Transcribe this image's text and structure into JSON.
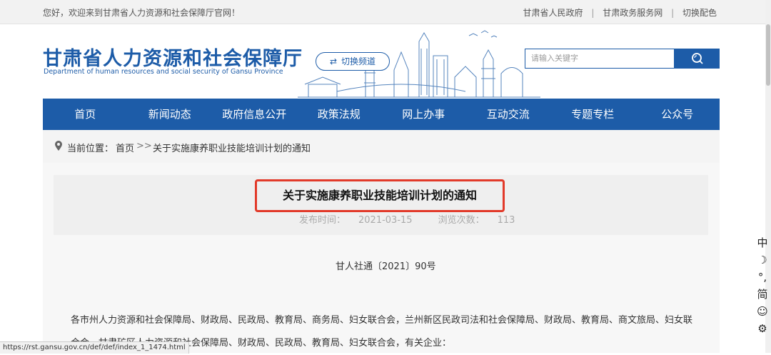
{
  "topbar": {
    "welcome": "您好，欢迎来到甘肃省人力资源和社会保障厅官网！",
    "links": [
      "甘肃省人民政府",
      "甘肃政务服务网",
      "切换配色"
    ],
    "separator": "|"
  },
  "header": {
    "title_cn": "甘肃省人力资源和社会保障厅",
    "title_en": "Department of human resources and social security of Gansu Province",
    "switch_label": "切换频道",
    "search_placeholder": "请输入关键字"
  },
  "nav": {
    "items": [
      "首页",
      "新闻动态",
      "政府信息公开",
      "政策法规",
      "网上办事",
      "互动交流",
      "专题专栏",
      "公众号"
    ]
  },
  "breadcrumb": {
    "label": "当前位置：",
    "home": "首页",
    "arrows": ">>",
    "current": "关于实施康养职业技能培训计划的通知"
  },
  "article": {
    "title": "关于实施康养职业技能培训计划的通知",
    "publish_label": "发布时间：",
    "publish_date": "2021-03-15",
    "views_label": "浏览次数：",
    "views": "113",
    "doc_number": "甘人社通〔2021〕90号",
    "paragraph": "各市州人力资源和社会保障局、财政局、民政局、教育局、商务局、妇女联合会，兰州新区民政司法和社会保障局、财政局、教育局、商文旅局、妇女联合会，甘肃矿区人力资源和社会保障局、财政局、民政局、教育局、妇女联合会，有关企业："
  },
  "status_url": "https://rst.gansu.gov.cn/def/def/index_1_1474.html",
  "tools": [
    "中",
    "☽",
    "°,",
    "简",
    "☺",
    "⚙"
  ],
  "icons": {
    "location": "location-pin-icon",
    "search": "search-icon",
    "switch": "shuffle-icon"
  },
  "colors": {
    "brand": "#1d5ca8",
    "highlight": "#e23a2a"
  }
}
